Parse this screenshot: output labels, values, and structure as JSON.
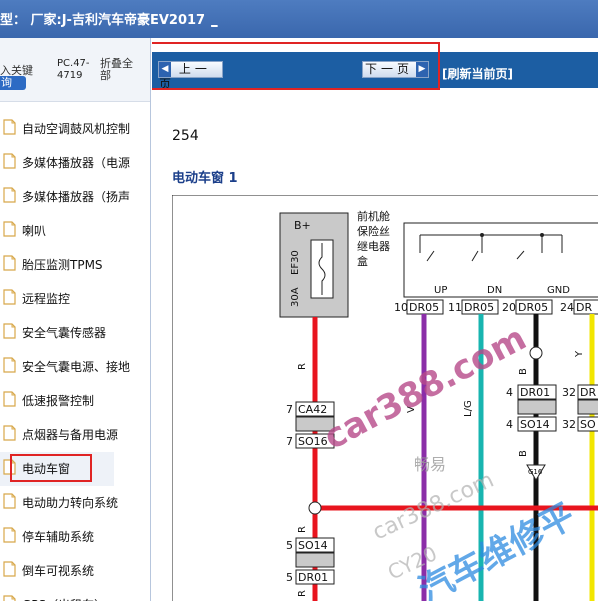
{
  "header": {
    "title": "型：  厂家:J-吉利汽车帝豪EV2017",
    "link": "_"
  },
  "sidebar": {
    "keyword_label": "入关键",
    "query_button": "询",
    "pc_code": "PC.47-4719",
    "fold_label": "折叠全部",
    "items": [
      {
        "label": "自动空调鼓风机控制"
      },
      {
        "label": "多媒体播放器（电源"
      },
      {
        "label": "多媒体播放器（扬声"
      },
      {
        "label": "喇叭"
      },
      {
        "label": "胎压监测TPMS"
      },
      {
        "label": "远程监控"
      },
      {
        "label": "安全气囊传感器"
      },
      {
        "label": "安全气囊电源、接地"
      },
      {
        "label": "低速报警控制"
      },
      {
        "label": "点烟器与备用电源"
      },
      {
        "label": "电动车窗"
      },
      {
        "label": "电动助力转向系统"
      },
      {
        "label": "停车辅助系统"
      },
      {
        "label": "倒车可视系统"
      },
      {
        "label": "GPS（出租车）"
      }
    ],
    "selected_index": 10
  },
  "nav": {
    "prev_label": "上一页",
    "next_label": "下一页",
    "refresh_label": "[刷新当前页]"
  },
  "content": {
    "page_number": "254",
    "section_title": "电动车窗 1"
  },
  "diagram": {
    "fuse_box": {
      "bplus": "B+",
      "fuse_id": "EF30",
      "rating": "30A"
    },
    "relay_label": [
      "前机舱",
      "保险丝",
      "继电器",
      "盒"
    ],
    "relay_pins": [
      "UP",
      "DN",
      "GND"
    ],
    "top_connectors": [
      {
        "pin": "10",
        "conn": "DR05"
      },
      {
        "pin": "11",
        "conn": "DR05"
      },
      {
        "pin": "20",
        "conn": "DR05"
      },
      {
        "pin": "24",
        "conn": "DR"
      }
    ],
    "wire_labels": {
      "r1": "R",
      "v": "V",
      "lg": "L/G",
      "b1": "B",
      "b2": "B",
      "y": "Y",
      "r2": "R",
      "r3": "R"
    },
    "left_connectors": [
      {
        "pin": "7",
        "conn": "CA42"
      },
      {
        "pin": "7",
        "conn": "SO16"
      },
      {
        "pin": "5",
        "conn": "SO14"
      },
      {
        "pin": "5",
        "conn": "DR01"
      }
    ],
    "mid_connectors": [
      {
        "pin": "4",
        "conn": "DR01"
      },
      {
        "pin": "4",
        "conn": "SO14"
      }
    ],
    "right_connectors": [
      {
        "pin": "32",
        "conn": "DR"
      },
      {
        "pin": "32",
        "conn": "SO"
      }
    ],
    "ground_label": "G16",
    "watermarks": [
      "car388.com",
      "畅易",
      "car388.com",
      "CY20",
      "汽车维修平"
    ]
  },
  "colors": {
    "red": "#e8141e",
    "purple": "#8b2ea8",
    "teal": "#18b5b0",
    "yellow": "#f2e600",
    "navy": "#1c5ea3"
  }
}
